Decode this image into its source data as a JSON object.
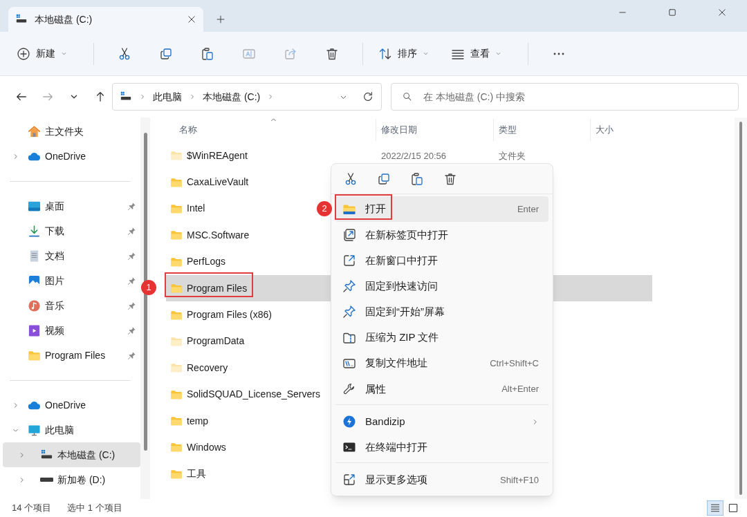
{
  "window": {
    "tab_title": "本地磁盘 (C:)"
  },
  "toolbar": [
    {
      "kind": "new",
      "label": "新建",
      "disabled": false
    },
    {
      "kind": "cut",
      "disabled": false
    },
    {
      "kind": "copy",
      "disabled": false
    },
    {
      "kind": "paste",
      "disabled": false
    },
    {
      "kind": "rename",
      "disabled": true
    },
    {
      "kind": "share",
      "disabled": true
    },
    {
      "kind": "delete",
      "disabled": false
    },
    {
      "kind": "sort",
      "label": "排序",
      "disabled": false
    },
    {
      "kind": "view",
      "label": "查看",
      "disabled": false
    },
    {
      "kind": "more",
      "disabled": false
    }
  ],
  "address": {
    "crumbs": [
      "此电脑",
      "本地磁盘 (C:)"
    ]
  },
  "search": {
    "placeholder": "在 本地磁盘 (C:) 中搜索"
  },
  "sidebar": {
    "sections": [
      [
        {
          "kind": "home",
          "label": "主文件夹",
          "selected": false
        },
        {
          "kind": "cloud",
          "label": "OneDrive",
          "expanded": false,
          "selected": false
        }
      ],
      [
        {
          "kind": "desktop",
          "label": "桌面",
          "pinned": true,
          "selected": false
        },
        {
          "kind": "download",
          "label": "下载",
          "pinned": true,
          "selected": false
        },
        {
          "kind": "document",
          "label": "文档",
          "pinned": true,
          "selected": false
        },
        {
          "kind": "picture",
          "label": "图片",
          "pinned": true,
          "selected": false
        },
        {
          "kind": "music",
          "label": "音乐",
          "pinned": true,
          "selected": false
        },
        {
          "kind": "video",
          "label": "视频",
          "pinned": true,
          "selected": false
        },
        {
          "kind": "folder",
          "label": "Program Files",
          "pinned": true,
          "selected": false
        }
      ],
      [
        {
          "kind": "cloud",
          "label": "OneDrive",
          "expanded": false,
          "selected": false
        },
        {
          "kind": "pc",
          "label": "此电脑",
          "expanded": true,
          "selected": false,
          "children": [
            {
              "kind": "drive",
              "label": "本地磁盘 (C:)",
              "expanded": false,
              "selected": true
            },
            {
              "kind": "disk",
              "label": "新加卷 (D:)",
              "expanded": false,
              "selected": false
            }
          ]
        }
      ]
    ]
  },
  "table": {
    "columns": [
      "名称",
      "修改日期",
      "类型",
      "大小"
    ],
    "rows": [
      {
        "name": "$WinREAgent",
        "date": "2022/2/15 20:56",
        "type": "文件夹",
        "selected": false,
        "faded": true
      },
      {
        "name": "CaxaLiveVault",
        "selected": false,
        "faded": false
      },
      {
        "name": "Intel",
        "selected": false,
        "faded": false
      },
      {
        "name": "MSC.Software",
        "selected": false,
        "faded": false
      },
      {
        "name": "PerfLogs",
        "selected": false,
        "faded": false
      },
      {
        "name": "Program Files",
        "selected": true,
        "faded": false,
        "callout": "1"
      },
      {
        "name": "Program Files (x86)",
        "selected": false,
        "faded": false
      },
      {
        "name": "ProgramData",
        "selected": false,
        "faded": true
      },
      {
        "name": "Recovery",
        "selected": false,
        "faded": true
      },
      {
        "name": "SolidSQUAD_License_Servers",
        "selected": false,
        "faded": false
      },
      {
        "name": "temp",
        "selected": false,
        "faded": false
      },
      {
        "name": "Windows",
        "selected": false,
        "faded": false
      },
      {
        "name": "工具",
        "selected": false,
        "faded": false
      }
    ]
  },
  "context_menu": {
    "quick_actions": [
      {
        "kind": "cut"
      },
      {
        "kind": "copy"
      },
      {
        "kind": "paste"
      },
      {
        "kind": "delete"
      }
    ],
    "groups": [
      [
        {
          "kind": "open",
          "label": "打开",
          "shortcut": "Enter",
          "selected": true,
          "callout": "2"
        },
        {
          "kind": "newtab",
          "label": "在新标签页中打开",
          "selected": false
        },
        {
          "kind": "newwindow",
          "label": "在新窗口中打开",
          "selected": false
        },
        {
          "kind": "pin",
          "label": "固定到快速访问",
          "selected": false
        },
        {
          "kind": "pin",
          "label": "固定到“开始”屏幕",
          "selected": false
        },
        {
          "kind": "zip",
          "label": "压缩为 ZIP 文件",
          "selected": false
        },
        {
          "kind": "path",
          "label": "复制文件地址",
          "shortcut": "Ctrl+Shift+C",
          "selected": false
        },
        {
          "kind": "properties",
          "label": "属性",
          "shortcut": "Alt+Enter",
          "selected": false
        }
      ],
      [
        {
          "kind": "bandizip",
          "label": "Bandizip",
          "submenu": true,
          "selected": false
        },
        {
          "kind": "terminal",
          "label": "在终端中打开",
          "selected": false
        }
      ],
      [
        {
          "kind": "more",
          "label": "显示更多选项",
          "shortcut": "Shift+F10",
          "selected": false
        }
      ]
    ]
  },
  "status_bar": {
    "count": "14 个项目",
    "selection": "选中 1 个项目"
  },
  "view_buttons": [
    {
      "kind": "details",
      "selected": true
    },
    {
      "kind": "tiles",
      "selected": false
    }
  ]
}
